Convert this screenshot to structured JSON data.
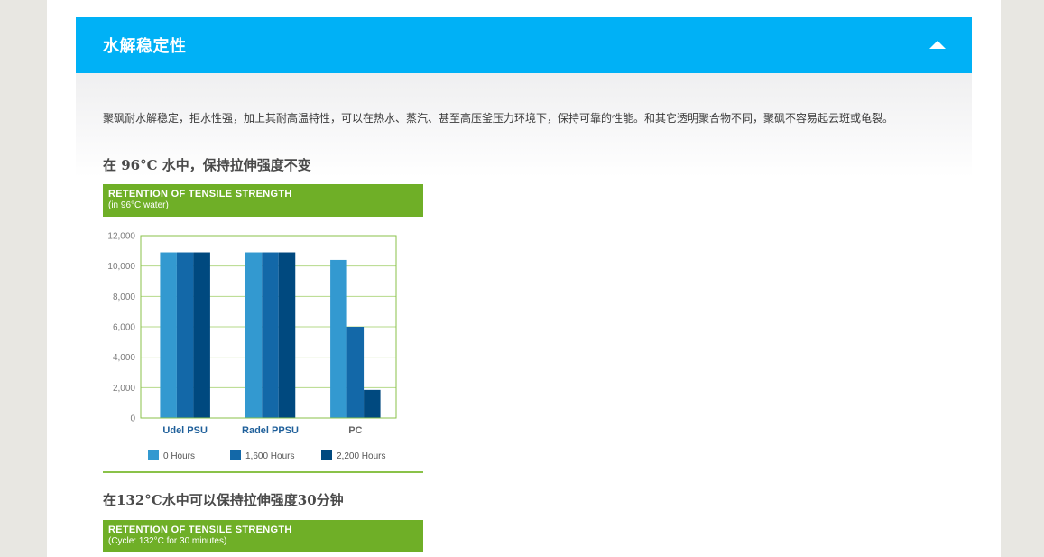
{
  "accordion": {
    "title": "水解稳定性",
    "toggle_icon": "chevron-up-icon",
    "accent_color": "#00b1f6"
  },
  "content": {
    "intro": "聚砜耐水解稳定，拒水性强，加上其耐高温特性，可以在热水、蒸汽、甚至高压釜压力环境下，保持可靠的性能。和其它透明聚合物不同，聚砜不容易起云斑或龟裂。",
    "heading1": "在 96°C 水中，保持拉伸强度不变",
    "chart1_banner": {
      "title": "RETENTION OF TENSILE STRENGTH",
      "subtitle": "(in 96°C water)"
    },
    "heading2": "在132°C水中可以保持拉伸强度30分钟",
    "chart2_banner": {
      "title": "RETENTION OF TENSILE STRENGTH",
      "subtitle": "(Cycle: 132°C for 30 minutes)"
    }
  },
  "chart_data": {
    "type": "bar",
    "categories": [
      "Udel PSU",
      "Radel PPSU",
      "PC"
    ],
    "series": [
      {
        "name": "0 Hours",
        "color": "#3399d0",
        "values": [
          10900,
          10900,
          10400
        ]
      },
      {
        "name": "1,600 Hours",
        "color": "#1368a8",
        "values": [
          10900,
          10900,
          6000
        ]
      },
      {
        "name": "2,200 Hours",
        "color": "#00497f",
        "values": [
          10900,
          10900,
          1850
        ]
      }
    ],
    "ylim": [
      0,
      12000
    ],
    "yticks": [
      0,
      2000,
      4000,
      6000,
      8000,
      10000,
      12000
    ],
    "ytick_labels": [
      "0",
      "2,000",
      "4,000",
      "6,000",
      "8,000",
      "10,000",
      "12,000"
    ],
    "category_label_colors": [
      "#1e5f9a",
      "#1e5f9a",
      "#666666"
    ],
    "grid": true,
    "legend_position": "bottom",
    "border_color": "#8ac249"
  }
}
